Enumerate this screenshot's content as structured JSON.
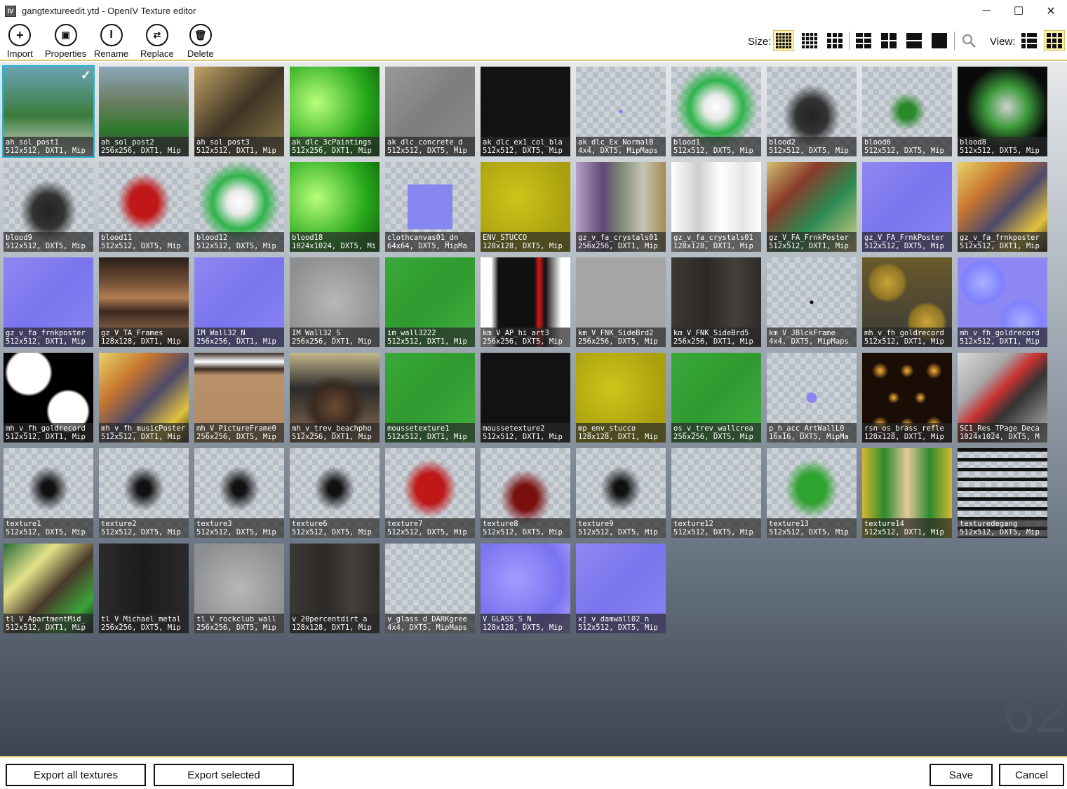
{
  "window": {
    "title": "gangtextureedit.ytd - OpenIV Texture editor",
    "app_icon": "IV"
  },
  "window_controls": {
    "minimize": "─",
    "maximize": "☐",
    "close": "✕"
  },
  "toolbar": {
    "import": "Import",
    "properties": "Properties",
    "rename": "Rename",
    "replace": "Replace",
    "delete": "Delete",
    "size_label": "Size:",
    "view_label": "View:"
  },
  "textures": [
    {
      "name": "ah_sol_post1",
      "info": "512x512, DXT1, Mip",
      "look": "poster-green",
      "selected": true
    },
    {
      "name": "ah_sol_post2",
      "info": "256x256, DXT1, Mip",
      "look": "photo-green"
    },
    {
      "name": "ah_sol_post3",
      "info": "512x512, DXT1, Mip",
      "look": "photo-tan"
    },
    {
      "name": "ak_dlc_3cPaintings",
      "info": "512x256, DXT1, Mip",
      "look": "bright-green"
    },
    {
      "name": "ak_dlc_concrete_d",
      "info": "512x512, DXT5, Mip",
      "look": "concrete"
    },
    {
      "name": "ak_dlc_ex1_col_bla",
      "info": "512x512, DXT5, Mip",
      "look": "black"
    },
    {
      "name": "ak_dlc_Ex_NormalB",
      "info": "4x4, DXT5, MipMaps",
      "look": "tiny-blue"
    },
    {
      "name": "blood1",
      "info": "512x512, DXT5, Mip",
      "look": "skull-green"
    },
    {
      "name": "blood2",
      "info": "512x512, DXT5, Mip",
      "look": "logo-dark"
    },
    {
      "name": "blood6",
      "info": "512x512, DXT5, Mip",
      "look": "logo-green"
    },
    {
      "name": "blood8",
      "info": "512x512, DXT5, Mip",
      "look": "dark-green"
    },
    {
      "name": "blood9",
      "info": "512x512, DXT5, Mip",
      "look": "logo-dark"
    },
    {
      "name": "blood11",
      "info": "512x512, DXT5, Mip",
      "look": "text-red"
    },
    {
      "name": "blood12",
      "info": "512x512, DXT5, Mip",
      "look": "skull-green"
    },
    {
      "name": "blood18",
      "info": "1024x1024, DXT5, Mi",
      "look": "bright-green"
    },
    {
      "name": "clothcanvas01_dn",
      "info": "64x64, DXT5, MipMa",
      "look": "small-normal"
    },
    {
      "name": "ENV_STUCCO",
      "info": "128x128, DXT5, Mip",
      "look": "stucco"
    },
    {
      "name": "gz_v_fa_crystals01",
      "info": "256x256, DXT1, Mip",
      "look": "collage-purple"
    },
    {
      "name": "gz_v_fa_crystals01",
      "info": "128x128, DXT1, Mip",
      "look": "white-gradient"
    },
    {
      "name": "gz_V_FA_FrnkPoster",
      "info": "512x512, DXT1, Mip",
      "look": "collage-red"
    },
    {
      "name": "gz_V_FA_FrnkPoster",
      "info": "512x512, DXT5, Mip",
      "look": "normal"
    },
    {
      "name": "gz_v_fa_frnkposter",
      "info": "512x512, DXT1, Mip",
      "look": "collage-yellow"
    },
    {
      "name": "gz_v_fa_frnkposter",
      "info": "512x512, DXT1, Mip",
      "look": "normal"
    },
    {
      "name": "gz_V_TA_Frames",
      "info": "128x128, DXT1, Mip",
      "look": "wood-stripes"
    },
    {
      "name": "IM_Wall32_N",
      "info": "256x256, DXT1, Mip",
      "look": "normal"
    },
    {
      "name": "IM_Wall32_S",
      "info": "256x256, DXT1, Mip",
      "look": "concrete-light"
    },
    {
      "name": "im_wall3222",
      "info": "512x512, DXT1, Mip",
      "look": "green"
    },
    {
      "name": "km_V_AP_hi_art3",
      "info": "256x256, DXT5, Mip",
      "look": "art-black"
    },
    {
      "name": "km_V_FNK_SideBrd2",
      "info": "256x256, DXT5, Mip",
      "look": "grey"
    },
    {
      "name": "km_V_FNK_SideBrd5",
      "info": "256x256, DXT1, Mip",
      "look": "dark-wood"
    },
    {
      "name": "km_V_JBlckFrame",
      "info": "4x4, DXT5, MipMaps",
      "look": "tiny-black"
    },
    {
      "name": "mh_v_fh_goldrecord",
      "info": "512x512, DXT1, Mip",
      "look": "gold-records"
    },
    {
      "name": "mh_v_fh_goldrecord",
      "info": "512x512, DXT1, Mip",
      "look": "normal-records"
    },
    {
      "name": "mh_v_fh_goldrecord",
      "info": "512x512, DXT1, Mip",
      "look": "bw-records"
    },
    {
      "name": "mh_v_fh_musicPoster",
      "info": "512x512, DXT1, Mip",
      "look": "collage-yellow"
    },
    {
      "name": "mh_V_PictureFrame0",
      "info": "256x256, DXT5, Mip",
      "look": "frame-brown"
    },
    {
      "name": "mh_v_trev_beachpho",
      "info": "512x256, DXT1, Mip",
      "look": "photo-faces"
    },
    {
      "name": "moussetexture1",
      "info": "512x512, DXT1, Mip",
      "look": "green"
    },
    {
      "name": "moussetexture2",
      "info": "512x512, DXT1, Mip",
      "look": "black"
    },
    {
      "name": "mp_env_stucco",
      "info": "128x128, DXT1, Mip",
      "look": "stucco"
    },
    {
      "name": "os_v_trev_wallcrea",
      "info": "256x256, DXT5, Mip",
      "look": "green"
    },
    {
      "name": "p_h_acc_ArtWallL0",
      "info": "16x16, DXT5, MipMa",
      "look": "tiny-purple"
    },
    {
      "name": "rsn_os_brass_refle",
      "info": "128x128, DXT1, Mip",
      "look": "lights"
    },
    {
      "name": "SC1_Res_TPage_Deca",
      "info": "1024x1024, DXT5, M",
      "look": "graffiti-wall"
    },
    {
      "name": "texture1",
      "info": "512x512, DXT5, Mip",
      "look": "tag"
    },
    {
      "name": "texture2",
      "info": "512x512, DXT5, Mip",
      "look": "tag"
    },
    {
      "name": "texture3",
      "info": "512x512, DXT5, Mip",
      "look": "tag"
    },
    {
      "name": "texture6",
      "info": "512x512, DXT5, Mip",
      "look": "tag"
    },
    {
      "name": "texture7",
      "info": "512x512, DXT5, Mip",
      "look": "text-red"
    },
    {
      "name": "texture8",
      "info": "512x512, DXT5, Mip",
      "look": "text-maroon"
    },
    {
      "name": "texture9",
      "info": "512x512, DXT5, Mip",
      "look": "tag"
    },
    {
      "name": "texture12",
      "info": "512x512, DXT5, Mip",
      "look": "empty"
    },
    {
      "name": "texture13",
      "info": "512x512, DXT5, Mip",
      "look": "text-green"
    },
    {
      "name": "texture14",
      "info": "512x512, DXT1, Mip",
      "look": "stained-glass"
    },
    {
      "name": "texturedegang",
      "info": "512x512, DXT5, Mip",
      "look": "text-list"
    },
    {
      "name": "tl_V_ApartmentMid_",
      "info": "512x512, DXT1, Mip",
      "look": "collage-green"
    },
    {
      "name": "tl_V_Michael_metal",
      "info": "256x256, DXT5, Mip",
      "look": "dark-metal"
    },
    {
      "name": "tl_V_rockclub_wall",
      "info": "256x256, DXT5, Mip",
      "look": "concrete-light"
    },
    {
      "name": "v_20percentdirt_a",
      "info": "128x128, DXT1, Mip",
      "look": "dark-wood"
    },
    {
      "name": "v_glass_d_DARKgree",
      "info": "4x4, DXT5, MipMaps",
      "look": "empty"
    },
    {
      "name": "V_GLASS_S_N",
      "info": "128x128, DXT5, Mip",
      "look": "normal-soft"
    },
    {
      "name": "xj_v_damwall02_n",
      "info": "512x512, DXT5, Mip",
      "look": "normal"
    }
  ],
  "texture_count": "62",
  "footer": {
    "export_all": "Export all textures",
    "export_selected": "Export selected",
    "save": "Save",
    "cancel": "Cancel"
  }
}
